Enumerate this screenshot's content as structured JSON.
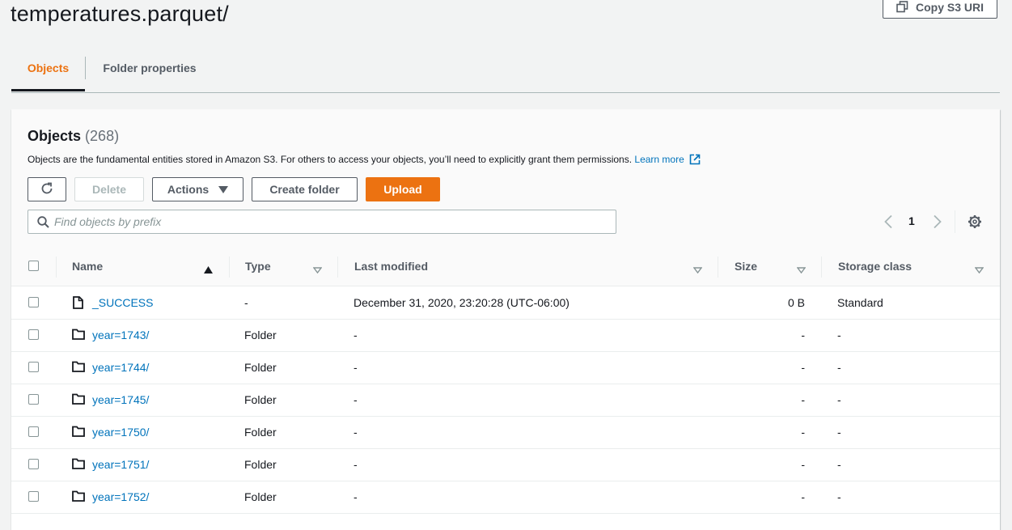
{
  "header": {
    "title": "temperatures.parquet/",
    "copy_uri_label": "Copy S3 URI"
  },
  "tabs": [
    {
      "label": "Objects",
      "active": true
    },
    {
      "label": "Folder properties",
      "active": false
    }
  ],
  "objects_panel": {
    "title": "Objects",
    "count": "(268)",
    "description": "Objects are the fundamental entities stored in Amazon S3. For others to access your objects, you’ll need to explicitly grant them permissions.",
    "learn_more": "Learn more",
    "buttons": {
      "refresh_icon": "refresh-icon",
      "delete": "Delete",
      "actions": "Actions",
      "create_folder": "Create folder",
      "upload": "Upload"
    },
    "search": {
      "placeholder": "Find objects by prefix",
      "value": ""
    },
    "pagination": {
      "current_page": "1"
    }
  },
  "table": {
    "columns": [
      "Name",
      "Type",
      "Last modified",
      "Size",
      "Storage class"
    ],
    "sorted_column": "Name",
    "rows": [
      {
        "name": "_SUCCESS",
        "kind": "file",
        "type": "-",
        "last_modified": "December 31, 2020, 23:20:28 (UTC-06:00)",
        "size": "0 B",
        "storage_class": "Standard"
      },
      {
        "name": "year=1743/",
        "kind": "folder",
        "type": "Folder",
        "last_modified": "-",
        "size": "-",
        "storage_class": "-"
      },
      {
        "name": "year=1744/",
        "kind": "folder",
        "type": "Folder",
        "last_modified": "-",
        "size": "-",
        "storage_class": "-"
      },
      {
        "name": "year=1745/",
        "kind": "folder",
        "type": "Folder",
        "last_modified": "-",
        "size": "-",
        "storage_class": "-"
      },
      {
        "name": "year=1750/",
        "kind": "folder",
        "type": "Folder",
        "last_modified": "-",
        "size": "-",
        "storage_class": "-"
      },
      {
        "name": "year=1751/",
        "kind": "folder",
        "type": "Folder",
        "last_modified": "-",
        "size": "-",
        "storage_class": "-"
      },
      {
        "name": "year=1752/",
        "kind": "folder",
        "type": "Folder",
        "last_modified": "-",
        "size": "-",
        "storage_class": "-"
      }
    ]
  },
  "colors": {
    "accent": "#ec7211",
    "link": "#0073bb",
    "text": "#16191f",
    "muted": "#545b64"
  }
}
